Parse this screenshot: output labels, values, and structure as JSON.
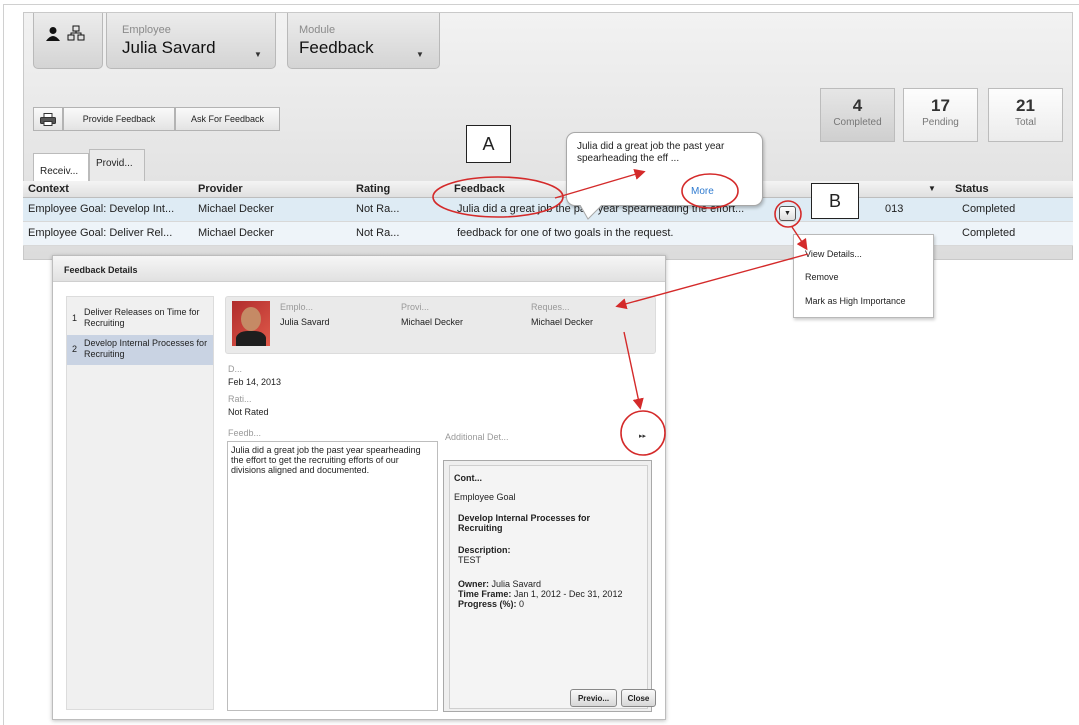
{
  "header": {
    "employee_label": "Employee",
    "employee_value": "Julia Savard",
    "module_label": "Module",
    "module_value": "Feedback"
  },
  "toolbar": {
    "provide_label": "Provide Feedback",
    "ask_label": "Ask For Feedback"
  },
  "stats": [
    {
      "count": "4",
      "label": "Completed"
    },
    {
      "count": "17",
      "label": "Pending"
    },
    {
      "count": "21",
      "label": "Total"
    }
  ],
  "tabs": [
    "Receiv...",
    "Provid..."
  ],
  "grid": {
    "columns": [
      "Context",
      "Provider",
      "Rating",
      "Feedback",
      "Status"
    ],
    "rows": [
      {
        "context": "Employee Goal: Develop Int...",
        "provider": "Michael Decker",
        "rating": "Not Ra...",
        "feedback": "Julia did a great job the past year spearheading the effort...",
        "date_fragment": "013",
        "status": "Completed"
      },
      {
        "context": "Employee Goal: Deliver Rel...",
        "provider": "Michael Decker",
        "rating": "Not Ra...",
        "feedback": "feedback for one of two goals in the request.",
        "date_fragment": "",
        "status": "Completed"
      }
    ]
  },
  "callout": {
    "text": "Julia did a great job the past year spearheading the eff ...",
    "more": "More"
  },
  "annotations": {
    "a": "A",
    "b": "B"
  },
  "row_menu": [
    "View Details...",
    "Remove",
    "Mark as High Importance"
  ],
  "dialog": {
    "title": "Feedback Details",
    "nav": [
      {
        "num": "1",
        "label": "Deliver Releases on Time for Recruiting"
      },
      {
        "num": "2",
        "label": "Develop Internal Processes for Recruiting"
      }
    ],
    "info": {
      "employee_label": "Emplo...",
      "employee": "Julia Savard",
      "provider_label": "Provi...",
      "provider": "Michael Decker",
      "requester_label": "Reques...",
      "requester": "Michael Decker"
    },
    "date_label": "D...",
    "date": "Feb 14, 2013",
    "rating_label": "Rati...",
    "rating": "Not Rated",
    "feedback_label": "Feedb...",
    "feedback_text": "Julia did a great job the past year spearheading the effort to get the recruiting efforts of our divisions aligned and documented.",
    "additional_label": "Additional Det...",
    "expand": "▸▸",
    "details": {
      "context_label": "Cont...",
      "context_value": "Employee Goal",
      "goal_title": "Develop Internal Processes for Recruiting",
      "description_label": "Description:",
      "description_value": "TEST",
      "owner_label": "Owner:",
      "owner_value": "Julia Savard",
      "timeframe_label": "Time Frame:",
      "timeframe_value": "Jan 1, 2012 - Dec 31, 2012",
      "progress_label": "Progress (%):",
      "progress_value": "0"
    },
    "prev_label": "Previo...",
    "close_label": "Close"
  },
  "colors": {
    "annotation": "#d42a2a",
    "link": "#2f7bd0",
    "selected_row": "#deebf4"
  }
}
